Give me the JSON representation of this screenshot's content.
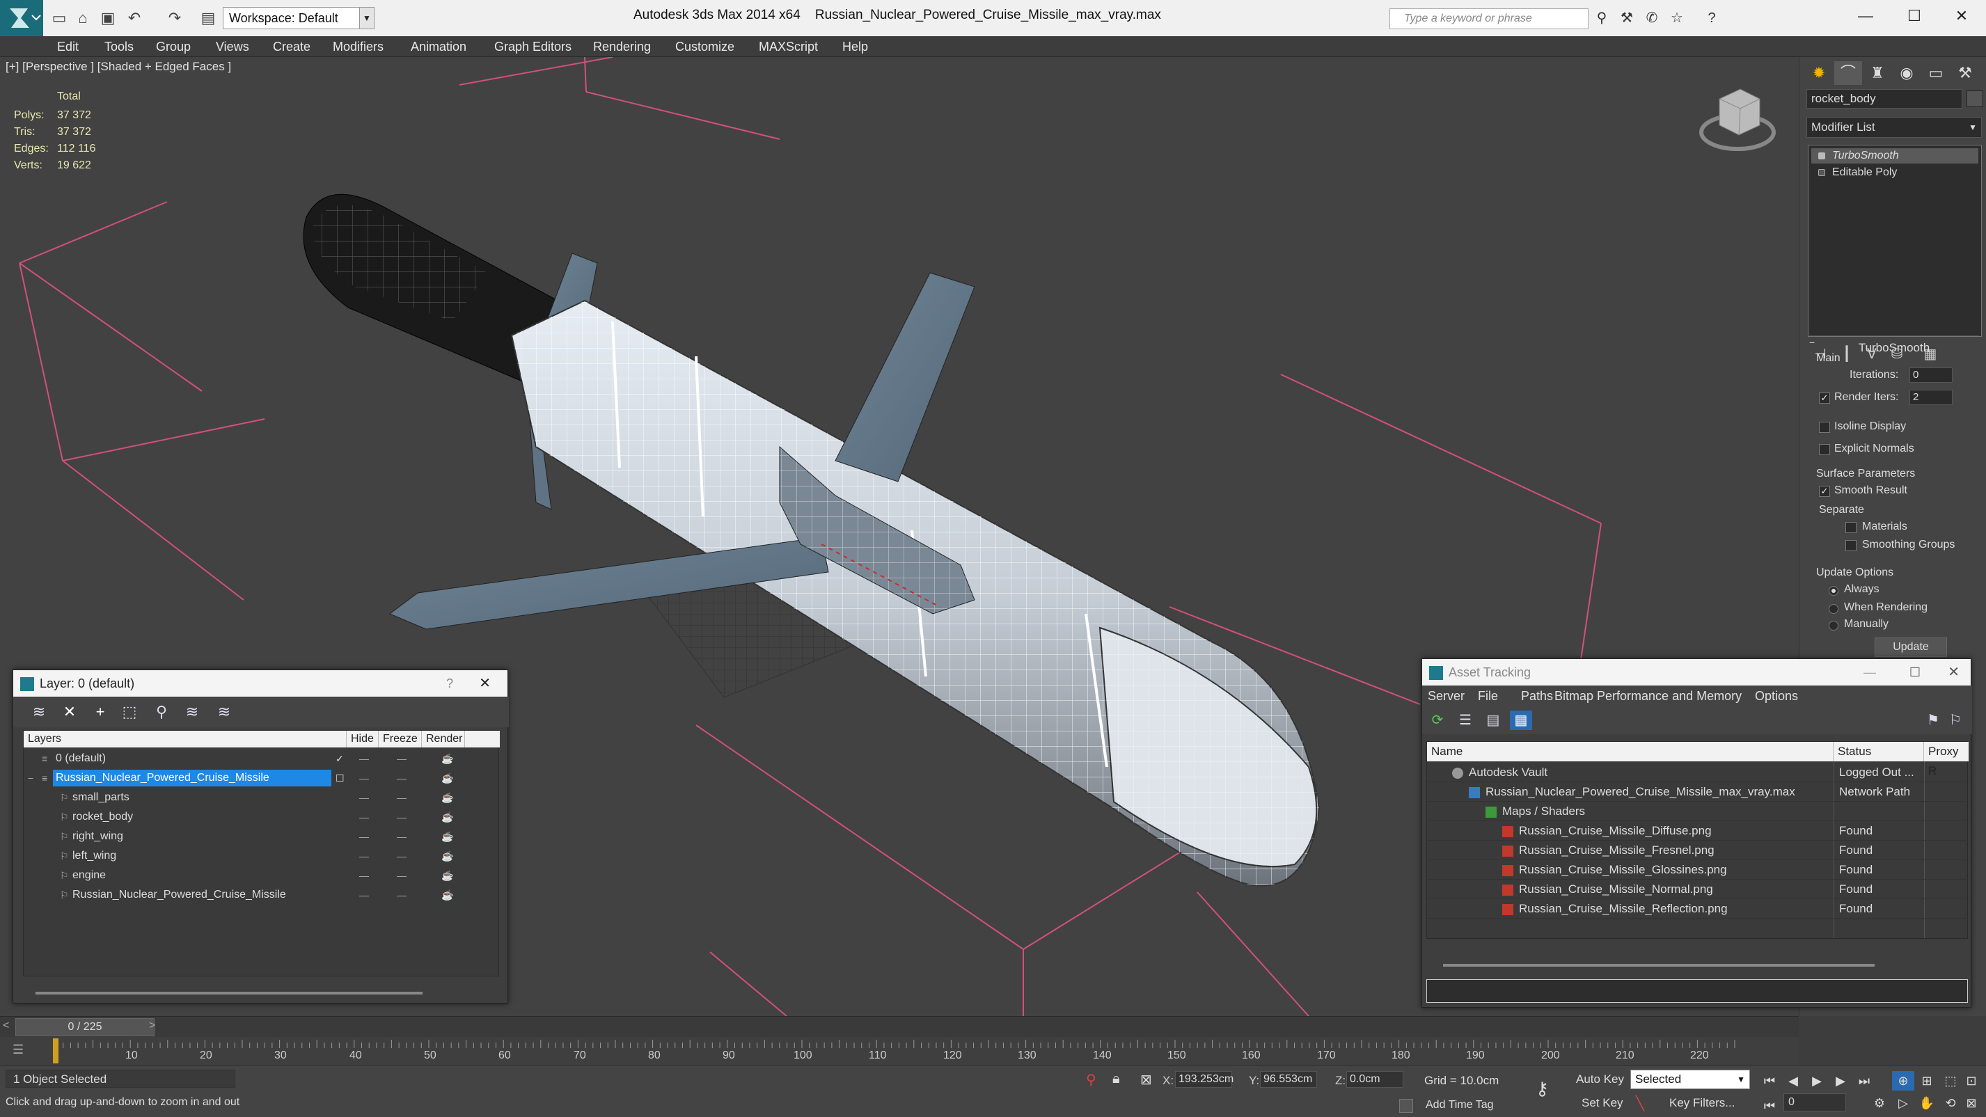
{
  "titlebar": {
    "workspace": "Workspace: Default",
    "app_title": "Autodesk 3ds Max  2014 x64",
    "file_title": "Russian_Nuclear_Powered_Cruise_Missile_max_vray.max",
    "search_placeholder": "Type a keyword or phrase"
  },
  "menu": [
    "Edit",
    "Tools",
    "Group",
    "Views",
    "Create",
    "Modifiers",
    "Animation",
    "Graph Editors",
    "Rendering",
    "Customize",
    "MAXScript",
    "Help"
  ],
  "viewport": {
    "label": "[+] [Perspective ] [Shaded + Edged Faces ]",
    "stats_header": "Total",
    "stats": [
      {
        "k": "Polys:",
        "v": "37 372"
      },
      {
        "k": "Tris:",
        "v": "37 372"
      },
      {
        "k": "Edges:",
        "v": "112 116"
      },
      {
        "k": "Verts:",
        "v": "19 622"
      }
    ]
  },
  "command_panel": {
    "object_name": "rocket_body",
    "modifier_list": "Modifier List",
    "stack": [
      "TurboSmooth",
      "Editable Poly"
    ],
    "rollout_title": "TurboSmooth",
    "main_group": "Main",
    "iterations_label": "Iterations:",
    "iterations_value": "0",
    "render_iters_label": "Render Iters:",
    "render_iters_value": "2",
    "render_iters_checked": true,
    "isoline_label": "Isoline Display",
    "explicit_normals_label": "Explicit Normals",
    "surface_params_label": "Surface Parameters",
    "smooth_result_label": "Smooth Result",
    "separate_label": "Separate",
    "materials_label": "Materials",
    "smoothing_groups_label": "Smoothing Groups",
    "update_options_label": "Update Options",
    "update_always": "Always",
    "update_when_rendering": "When Rendering",
    "update_manually": "Manually",
    "update_button": "Update"
  },
  "layer_window": {
    "title": "Layer: 0 (default)",
    "help": "?",
    "columns": {
      "layers": "Layers",
      "hide": "Hide",
      "freeze": "Freeze",
      "render": "Render"
    },
    "rows": [
      {
        "name": "0 (default)",
        "indent": 0
      },
      {
        "name": "Russian_Nuclear_Powered_Cruise_Missile",
        "indent": 0
      },
      {
        "name": "small_parts",
        "indent": 1
      },
      {
        "name": "rocket_body",
        "indent": 1
      },
      {
        "name": "right_wing",
        "indent": 1
      },
      {
        "name": "left_wing",
        "indent": 1
      },
      {
        "name": "engine",
        "indent": 1
      },
      {
        "name": "Russian_Nuclear_Powered_Cruise_Missile",
        "indent": 1
      }
    ]
  },
  "asset_window": {
    "title": "Asset Tracking",
    "menu": [
      "Server",
      "File",
      "Paths",
      "Bitmap Performance and Memory",
      "Options"
    ],
    "columns": {
      "name": "Name",
      "status": "Status",
      "proxy": "Proxy R"
    },
    "rows": [
      {
        "name": "Autodesk Vault",
        "status": "Logged Out ...",
        "indent": 1,
        "icon": "vault-icon"
      },
      {
        "name": "Russian_Nuclear_Powered_Cruise_Missile_max_vray.max",
        "status": "Network Path",
        "indent": 2,
        "icon": "max-file-icon"
      },
      {
        "name": "Maps / Shaders",
        "status": "",
        "indent": 3,
        "icon": "maps-icon"
      },
      {
        "name": "Russian_Cruise_Missile_Diffuse.png",
        "status": "Found",
        "indent": 4,
        "icon": "png-icon"
      },
      {
        "name": "Russian_Cruise_Missile_Fresnel.png",
        "status": "Found",
        "indent": 4,
        "icon": "png-icon"
      },
      {
        "name": "Russian_Cruise_Missile_Glossines.png",
        "status": "Found",
        "indent": 4,
        "icon": "png-icon"
      },
      {
        "name": "Russian_Cruise_Missile_Normal.png",
        "status": "Found",
        "indent": 4,
        "icon": "png-icon"
      },
      {
        "name": "Russian_Cruise_Missile_Reflection.png",
        "status": "Found",
        "indent": 4,
        "icon": "png-icon"
      }
    ]
  },
  "timeline": {
    "frame_label": "0 / 225",
    "ticks": [
      "10",
      "20",
      "30",
      "40",
      "50",
      "60",
      "70",
      "80",
      "90",
      "100",
      "110",
      "120",
      "130",
      "140",
      "150",
      "160",
      "170",
      "180",
      "190",
      "200",
      "210",
      "220"
    ]
  },
  "status": {
    "selection": "1 Object Selected",
    "prompt": "Click and drag up-and-down to zoom in and out",
    "x_label": "X:",
    "x_value": "193.253cm",
    "y_label": "Y:",
    "y_value": "96.553cm",
    "z_label": "Z:",
    "z_value": "0.0cm",
    "grid": "Grid = 10.0cm",
    "auto_key": "Auto Key",
    "selected_filter": "Selected",
    "set_key": "Set Key",
    "key_filters": "Key Filters...",
    "add_time_tag": "Add Time Tag",
    "current_frame": "0"
  },
  "colors": {
    "accent_blue": "#1e88e5",
    "found_text": "#e0e0e0",
    "stats_yellow": "#e8e8b0",
    "grid_pink": "#d2507a"
  }
}
